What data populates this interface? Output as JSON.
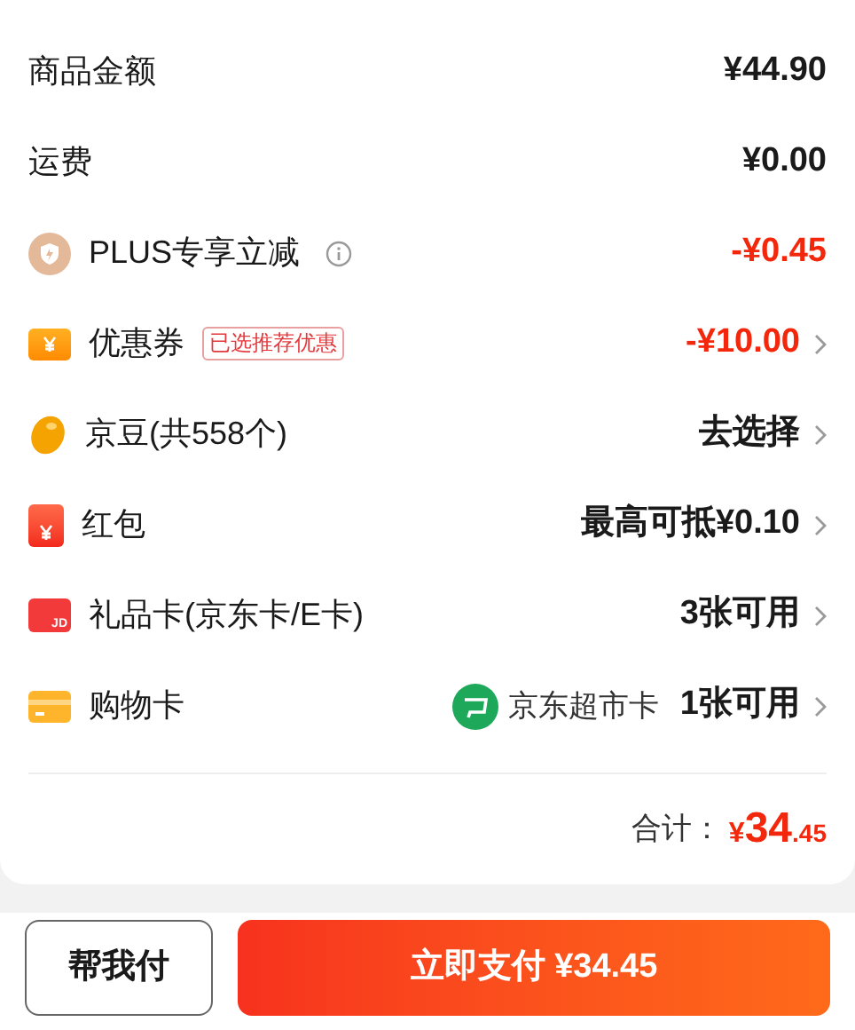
{
  "rows": [
    {
      "kind": "plain",
      "label": "商品金额",
      "value": "¥44.90",
      "highlight": false,
      "chevron": false
    },
    {
      "kind": "plain",
      "label": "运费",
      "value": "¥0.00",
      "highlight": false,
      "chevron": false
    },
    {
      "kind": "plus",
      "label": "PLUS专享立减",
      "info": true,
      "value": "-¥0.45",
      "highlight": true,
      "chevron": false
    },
    {
      "kind": "coupon",
      "label": "优惠券",
      "tag": "已选推荐优惠",
      "value": "-¥10.00",
      "highlight": true,
      "chevron": true
    },
    {
      "kind": "bean",
      "label": "京豆(共558个)",
      "value": "去选择",
      "highlight": false,
      "chevron": true
    },
    {
      "kind": "redpacket",
      "label": "红包",
      "value": "最高可抵¥0.10",
      "highlight": false,
      "chevron": true
    },
    {
      "kind": "giftcard",
      "label": "礼品卡(京东卡/E卡)",
      "card_text": "JD",
      "value": "3张可用",
      "highlight": false,
      "chevron": true
    },
    {
      "kind": "shopcard",
      "label": "购物卡",
      "badge": "京东超市卡",
      "value": "1张可用",
      "highlight": false,
      "chevron": true
    }
  ],
  "total": {
    "label": "合计：",
    "currency": "¥",
    "integer": "34",
    "decimal": ".45"
  },
  "buttons": [
    {
      "kind": "secondary",
      "label": "帮我付"
    },
    {
      "kind": "primary",
      "label": "立即支付 ¥34.45"
    }
  ]
}
